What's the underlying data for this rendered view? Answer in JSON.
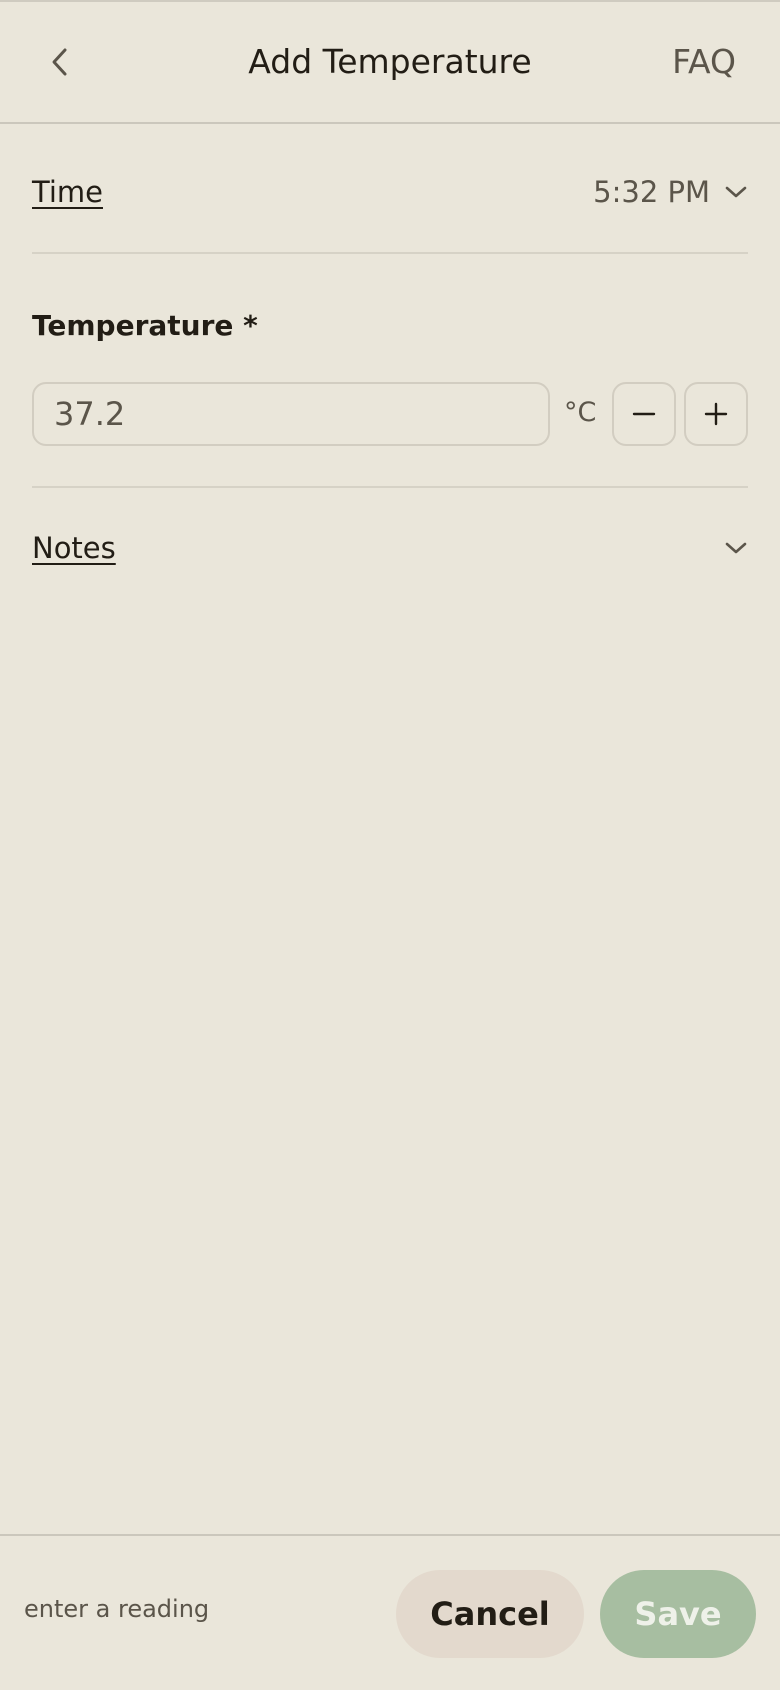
{
  "header": {
    "title": "Add Temperature",
    "faq_label": "FAQ",
    "back_icon": "chevron-left-icon"
  },
  "time": {
    "label": "Time",
    "value": "5:32 PM",
    "icon": "chevron-down-icon"
  },
  "temperature": {
    "label": "Temperature *",
    "value": "37.2",
    "unit": "°C",
    "decrement_icon": "minus-icon",
    "increment_icon": "plus-icon"
  },
  "notes": {
    "label": "Notes",
    "icon": "chevron-down-icon"
  },
  "footer": {
    "hint": "enter a reading",
    "cancel_label": "Cancel",
    "save_label": "Save"
  },
  "colors": {
    "background": "#eae6da",
    "text": "#221d15",
    "muted": "#5b554a",
    "cancel_bg": "#e3d9cd",
    "save_bg": "#a7bea1"
  }
}
